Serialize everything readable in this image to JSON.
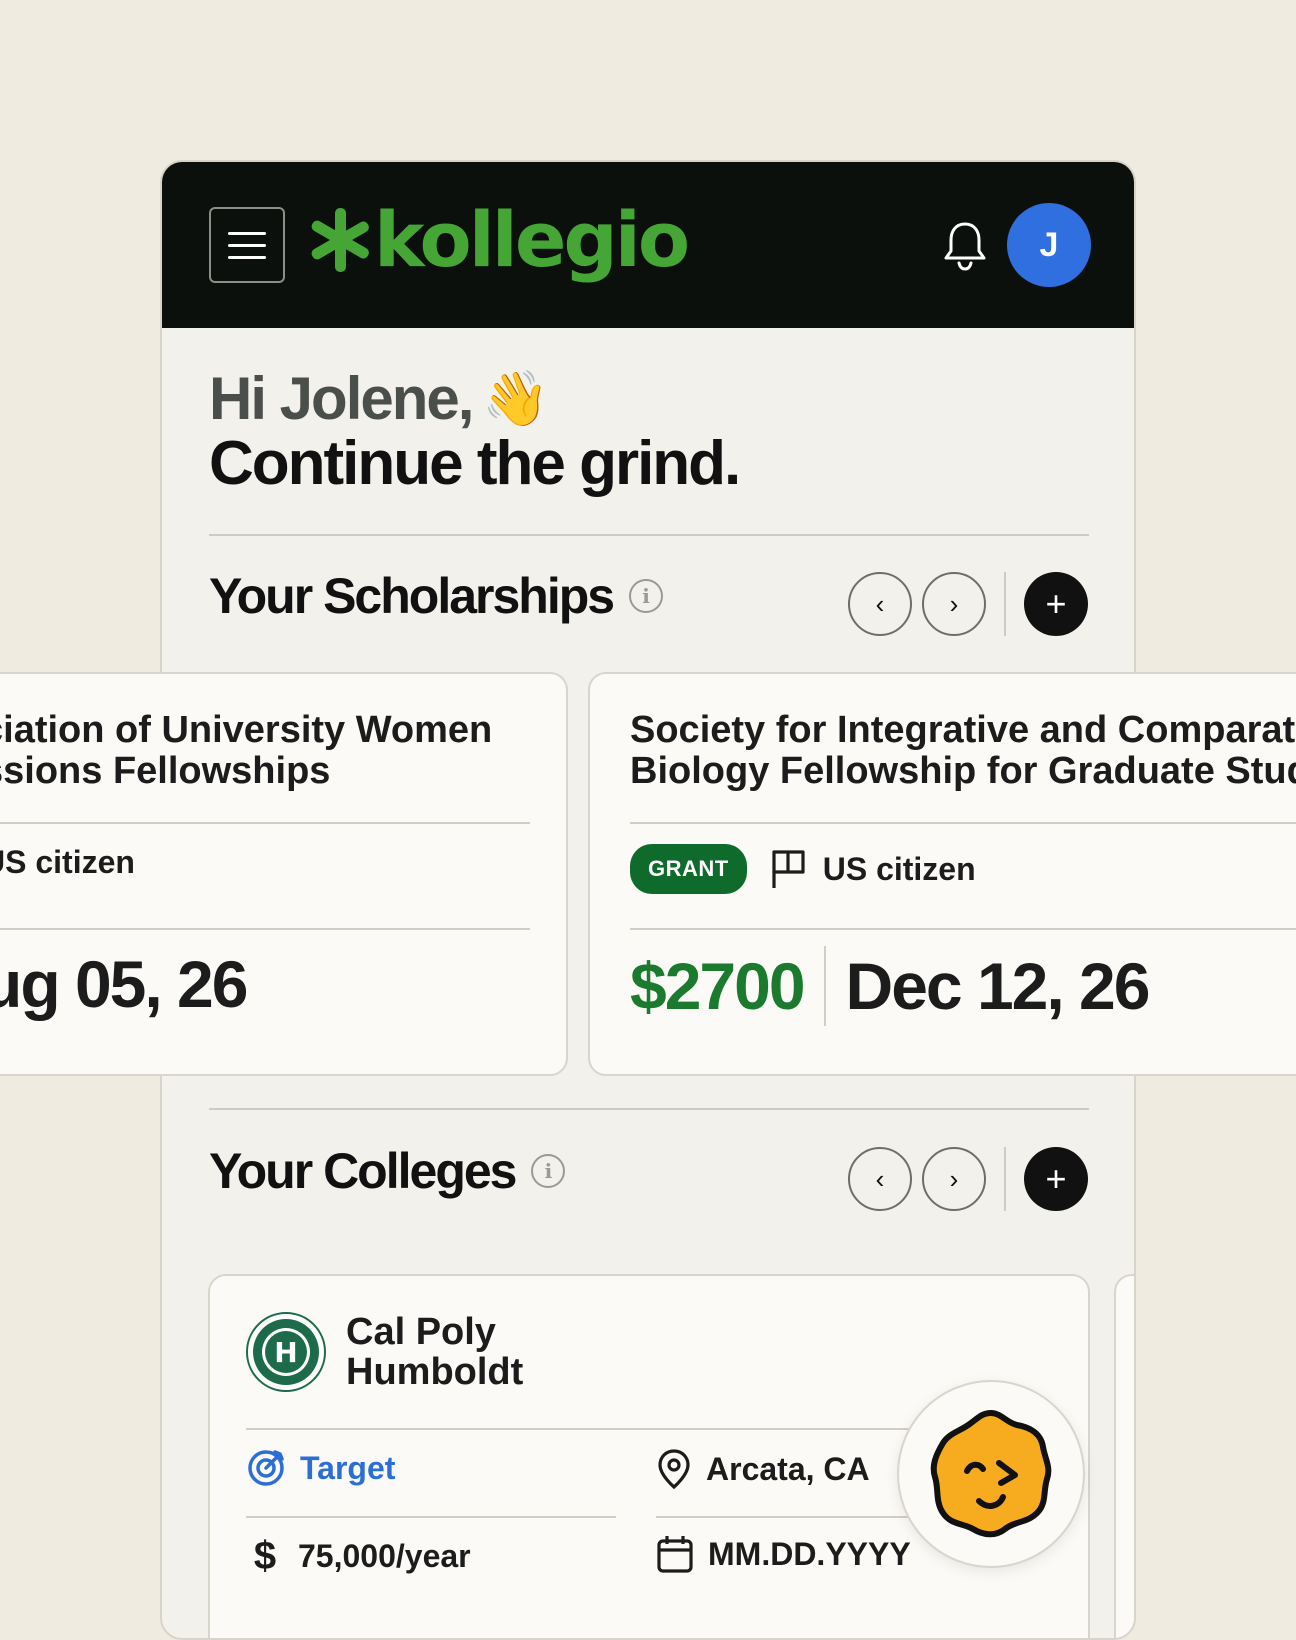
{
  "header": {
    "logo_text": "kollegio",
    "avatar_initial": "J",
    "brand_color": "#45a535"
  },
  "greeting": {
    "line1": "Hi Jolene,",
    "emoji": "👋",
    "line2": "Continue the grind."
  },
  "scholarships": {
    "title": "Your Scholarships",
    "cards": [
      {
        "title_line1": "ciation of University Women",
        "title_line2": "ssions Fellowships",
        "requirement": "US citizen",
        "deadline": "ug 05, 26"
      },
      {
        "title_line1": "Society for Integrative and Comparati",
        "title_line2": "Biology Fellowship for Graduate Stud",
        "badge": "GRANT",
        "requirement": "US citizen",
        "amount": "$2700",
        "deadline": "Dec 12, 26"
      }
    ]
  },
  "colleges": {
    "title": "Your Colleges",
    "cards": [
      {
        "name_line1": "Cal Poly",
        "name_line2": "Humboldt",
        "category": "Target",
        "location": "Arcata, CA",
        "cost": "75,000/year",
        "date": "MM.DD.YYYY"
      }
    ]
  },
  "icons": {
    "menu": "hamburger-menu-icon",
    "notifications": "bell-icon",
    "info": "info-icon",
    "prev": "chevron-left-icon",
    "next": "chevron-right-icon",
    "add": "plus-icon",
    "requirement": "flag-icon",
    "target": "target-icon",
    "location": "map-pin-icon",
    "cost": "dollar-icon",
    "date": "calendar-icon",
    "mascot": "mascot-icon"
  }
}
